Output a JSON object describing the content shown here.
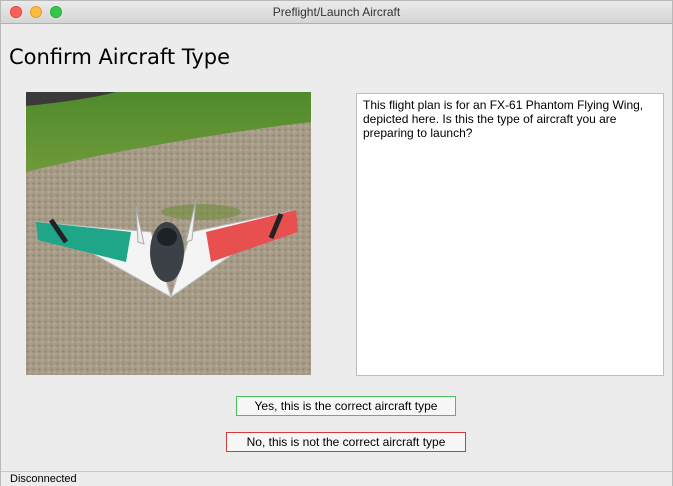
{
  "window": {
    "title": "Preflight/Launch Aircraft"
  },
  "page": {
    "title": "Confirm Aircraft Type"
  },
  "aircraft_image": {
    "alt": "FX-61 Phantom Flying Wing"
  },
  "description": "This flight plan is for an FX-61 Phantom Flying Wing, depicted here. Is this the type of aircraft you are preparing to launch?",
  "buttons": {
    "confirm_label": "Yes, this is the correct aircraft type",
    "reject_label": "No, this is not the correct aircraft type"
  },
  "status": {
    "connection": "Disconnected"
  },
  "colors": {
    "confirm_border": "#46c35a",
    "reject_border": "#d23b3b",
    "close": "#fc605c",
    "minimize": "#fdbc40",
    "zoom": "#34c84a"
  }
}
